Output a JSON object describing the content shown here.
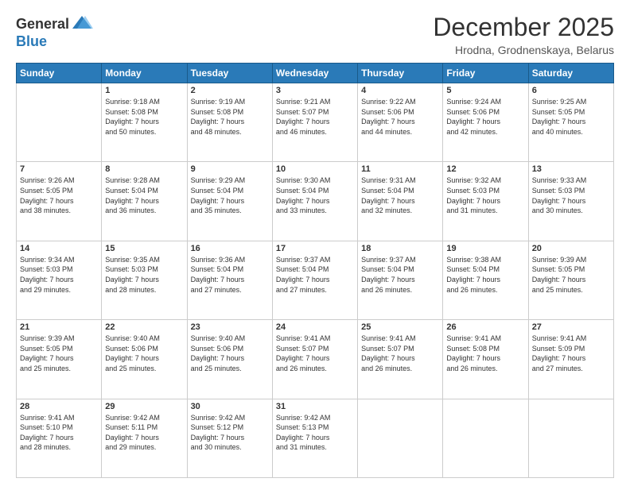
{
  "header": {
    "logo_line1": "General",
    "logo_line2": "Blue",
    "month": "December 2025",
    "location": "Hrodna, Grodnenskaya, Belarus"
  },
  "weekdays": [
    "Sunday",
    "Monday",
    "Tuesday",
    "Wednesday",
    "Thursday",
    "Friday",
    "Saturday"
  ],
  "weeks": [
    [
      {
        "day": "",
        "info": ""
      },
      {
        "day": "1",
        "info": "Sunrise: 9:18 AM\nSunset: 5:08 PM\nDaylight: 7 hours\nand 50 minutes."
      },
      {
        "day": "2",
        "info": "Sunrise: 9:19 AM\nSunset: 5:08 PM\nDaylight: 7 hours\nand 48 minutes."
      },
      {
        "day": "3",
        "info": "Sunrise: 9:21 AM\nSunset: 5:07 PM\nDaylight: 7 hours\nand 46 minutes."
      },
      {
        "day": "4",
        "info": "Sunrise: 9:22 AM\nSunset: 5:06 PM\nDaylight: 7 hours\nand 44 minutes."
      },
      {
        "day": "5",
        "info": "Sunrise: 9:24 AM\nSunset: 5:06 PM\nDaylight: 7 hours\nand 42 minutes."
      },
      {
        "day": "6",
        "info": "Sunrise: 9:25 AM\nSunset: 5:05 PM\nDaylight: 7 hours\nand 40 minutes."
      }
    ],
    [
      {
        "day": "7",
        "info": "Sunrise: 9:26 AM\nSunset: 5:05 PM\nDaylight: 7 hours\nand 38 minutes."
      },
      {
        "day": "8",
        "info": "Sunrise: 9:28 AM\nSunset: 5:04 PM\nDaylight: 7 hours\nand 36 minutes."
      },
      {
        "day": "9",
        "info": "Sunrise: 9:29 AM\nSunset: 5:04 PM\nDaylight: 7 hours\nand 35 minutes."
      },
      {
        "day": "10",
        "info": "Sunrise: 9:30 AM\nSunset: 5:04 PM\nDaylight: 7 hours\nand 33 minutes."
      },
      {
        "day": "11",
        "info": "Sunrise: 9:31 AM\nSunset: 5:04 PM\nDaylight: 7 hours\nand 32 minutes."
      },
      {
        "day": "12",
        "info": "Sunrise: 9:32 AM\nSunset: 5:03 PM\nDaylight: 7 hours\nand 31 minutes."
      },
      {
        "day": "13",
        "info": "Sunrise: 9:33 AM\nSunset: 5:03 PM\nDaylight: 7 hours\nand 30 minutes."
      }
    ],
    [
      {
        "day": "14",
        "info": "Sunrise: 9:34 AM\nSunset: 5:03 PM\nDaylight: 7 hours\nand 29 minutes."
      },
      {
        "day": "15",
        "info": "Sunrise: 9:35 AM\nSunset: 5:03 PM\nDaylight: 7 hours\nand 28 minutes."
      },
      {
        "day": "16",
        "info": "Sunrise: 9:36 AM\nSunset: 5:04 PM\nDaylight: 7 hours\nand 27 minutes."
      },
      {
        "day": "17",
        "info": "Sunrise: 9:37 AM\nSunset: 5:04 PM\nDaylight: 7 hours\nand 27 minutes."
      },
      {
        "day": "18",
        "info": "Sunrise: 9:37 AM\nSunset: 5:04 PM\nDaylight: 7 hours\nand 26 minutes."
      },
      {
        "day": "19",
        "info": "Sunrise: 9:38 AM\nSunset: 5:04 PM\nDaylight: 7 hours\nand 26 minutes."
      },
      {
        "day": "20",
        "info": "Sunrise: 9:39 AM\nSunset: 5:05 PM\nDaylight: 7 hours\nand 25 minutes."
      }
    ],
    [
      {
        "day": "21",
        "info": "Sunrise: 9:39 AM\nSunset: 5:05 PM\nDaylight: 7 hours\nand 25 minutes."
      },
      {
        "day": "22",
        "info": "Sunrise: 9:40 AM\nSunset: 5:06 PM\nDaylight: 7 hours\nand 25 minutes."
      },
      {
        "day": "23",
        "info": "Sunrise: 9:40 AM\nSunset: 5:06 PM\nDaylight: 7 hours\nand 25 minutes."
      },
      {
        "day": "24",
        "info": "Sunrise: 9:41 AM\nSunset: 5:07 PM\nDaylight: 7 hours\nand 26 minutes."
      },
      {
        "day": "25",
        "info": "Sunrise: 9:41 AM\nSunset: 5:07 PM\nDaylight: 7 hours\nand 26 minutes."
      },
      {
        "day": "26",
        "info": "Sunrise: 9:41 AM\nSunset: 5:08 PM\nDaylight: 7 hours\nand 26 minutes."
      },
      {
        "day": "27",
        "info": "Sunrise: 9:41 AM\nSunset: 5:09 PM\nDaylight: 7 hours\nand 27 minutes."
      }
    ],
    [
      {
        "day": "28",
        "info": "Sunrise: 9:41 AM\nSunset: 5:10 PM\nDaylight: 7 hours\nand 28 minutes."
      },
      {
        "day": "29",
        "info": "Sunrise: 9:42 AM\nSunset: 5:11 PM\nDaylight: 7 hours\nand 29 minutes."
      },
      {
        "day": "30",
        "info": "Sunrise: 9:42 AM\nSunset: 5:12 PM\nDaylight: 7 hours\nand 30 minutes."
      },
      {
        "day": "31",
        "info": "Sunrise: 9:42 AM\nSunset: 5:13 PM\nDaylight: 7 hours\nand 31 minutes."
      },
      {
        "day": "",
        "info": ""
      },
      {
        "day": "",
        "info": ""
      },
      {
        "day": "",
        "info": ""
      }
    ]
  ]
}
